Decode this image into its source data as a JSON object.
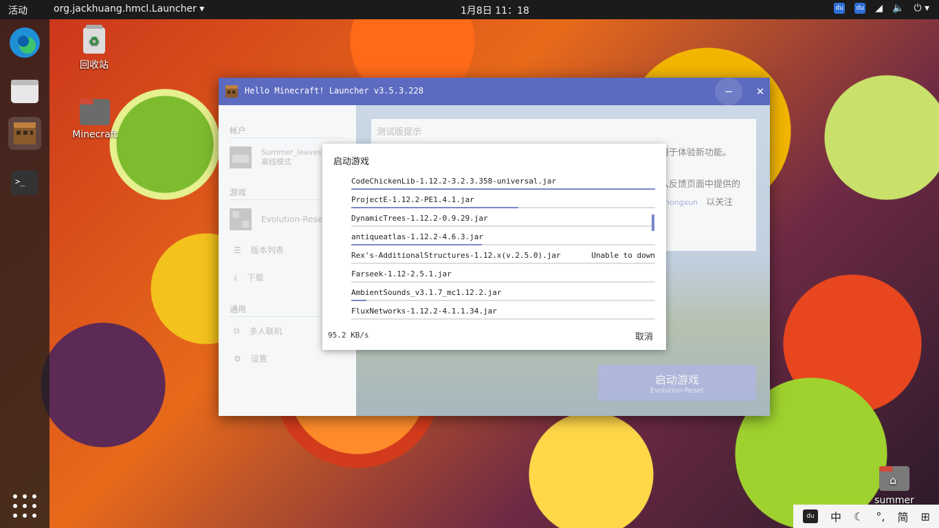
{
  "topbar": {
    "activities": "活动",
    "app_menu": "org.jackhuang.hmcl.Launcher",
    "clock": "1月8日 11：18"
  },
  "desktop": {
    "trash_label": "回收站",
    "minecraft_label": "Minecraft",
    "home_label": "summer"
  },
  "window": {
    "title": "Hello Minecraft! Launcher v3.5.3.228",
    "minimize": "–",
    "close": "✕"
  },
  "sidebar": {
    "account_section": "帐户",
    "account_name": "Summer_leaves",
    "account_type": "离线模式",
    "game_section": "游戏",
    "game_name": "Evolution-Reset",
    "version_list": "版本列表",
    "download": "下载",
    "general_section": "通用",
    "multiplayer": "多人联机",
    "settings": "设置"
  },
  "notice": {
    "title": "测试版提示",
    "line1": "用于体验新功能。",
    "line2": "入反馈页面中提供的",
    "line3_link": "ghongxun",
    "line3": "以关注"
  },
  "launch": {
    "label": "启动游戏",
    "sub": "Evolution-Reset"
  },
  "dialog": {
    "title": "启动游戏",
    "speed": "95.2 KB/s",
    "cancel": "取消",
    "tasks": [
      {
        "name": "CodeChickenLib-1.12.2-3.2.3.358-universal.jar",
        "status": "",
        "progress": 1.0
      },
      {
        "name": "ProjectE-1.12.2-PE1.4.1.jar",
        "status": "",
        "progress": 0.55
      },
      {
        "name": "DynamicTrees-1.12.2-0.9.29.jar",
        "status": "",
        "progress": 0.0
      },
      {
        "name": "antiqueatlas-1.12.2-4.6.3.jar",
        "status": "",
        "progress": 0.43
      },
      {
        "name": "Rex's-AdditionalStructures-1.12.x(v.2.5.0).jar",
        "status": "Unable to down",
        "progress": 0.0
      },
      {
        "name": "Farseek-1.12-2.5.1.jar",
        "status": "",
        "progress": 0.0
      },
      {
        "name": "AmbientSounds_v3.1.7_mc1.12.2.jar",
        "status": "",
        "progress": 0.05
      },
      {
        "name": "FluxNetworks-1.12.2-4.1.1.34.jar",
        "status": "",
        "progress": 0.0
      }
    ]
  },
  "ime": {
    "logo": "du",
    "lang": "中",
    "moon": "☾",
    "punct": "°,",
    "simp": "简",
    "grid": "⊞"
  },
  "colors": {
    "accent": "#5c6bc0",
    "progress": "#7986cb",
    "dock": "#1e1e1e"
  }
}
